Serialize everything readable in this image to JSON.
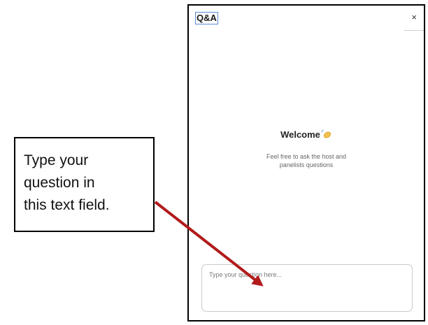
{
  "panel": {
    "title": "Q&A",
    "close_label": "×",
    "welcome": {
      "title": "Welcome",
      "subtitle_line1": "Feel free to ask the host and",
      "subtitle_line2": "panelists questions"
    },
    "question_input": {
      "placeholder": "Type your question here...",
      "value": ""
    }
  },
  "annotation": {
    "lines": [
      "Type your",
      "question in",
      "this text field."
    ],
    "arrow_color": "#b11b1b"
  },
  "icons": {
    "wave": "waving-hand-icon",
    "close": "close-icon"
  }
}
